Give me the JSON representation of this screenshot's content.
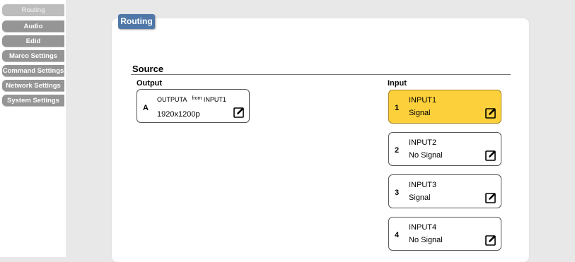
{
  "sidebar": {
    "items": [
      {
        "label": "Routing",
        "active": true
      },
      {
        "label": "Audio",
        "active": false
      },
      {
        "label": "Edid",
        "active": false
      },
      {
        "label": "Marco Settings",
        "active": false
      },
      {
        "label": "Command Settings",
        "active": false
      },
      {
        "label": "Network Settings",
        "active": false
      },
      {
        "label": "System Settings",
        "active": false
      }
    ]
  },
  "main": {
    "tab_title": "Routing",
    "section_title": "Source",
    "output_header": "Output",
    "input_header": "Input",
    "output": {
      "id": "A",
      "name": "OUTPUTA",
      "from_label": "from",
      "source": "INPUT1",
      "resolution": "1920x1200p"
    },
    "inputs": [
      {
        "num": "1",
        "name": "INPUT1",
        "status": "Signal",
        "selected": true
      },
      {
        "num": "2",
        "name": "INPUT2",
        "status": "No Signal",
        "selected": false
      },
      {
        "num": "3",
        "name": "INPUT3",
        "status": "Signal",
        "selected": false
      },
      {
        "num": "4",
        "name": "INPUT4",
        "status": "No Signal",
        "selected": false
      }
    ]
  },
  "colors": {
    "accent_tab": "#4f78a8",
    "selected_input": "#fcd03b",
    "sidebar_item": "#959595"
  },
  "icons": {
    "edit": "edit-icon"
  }
}
